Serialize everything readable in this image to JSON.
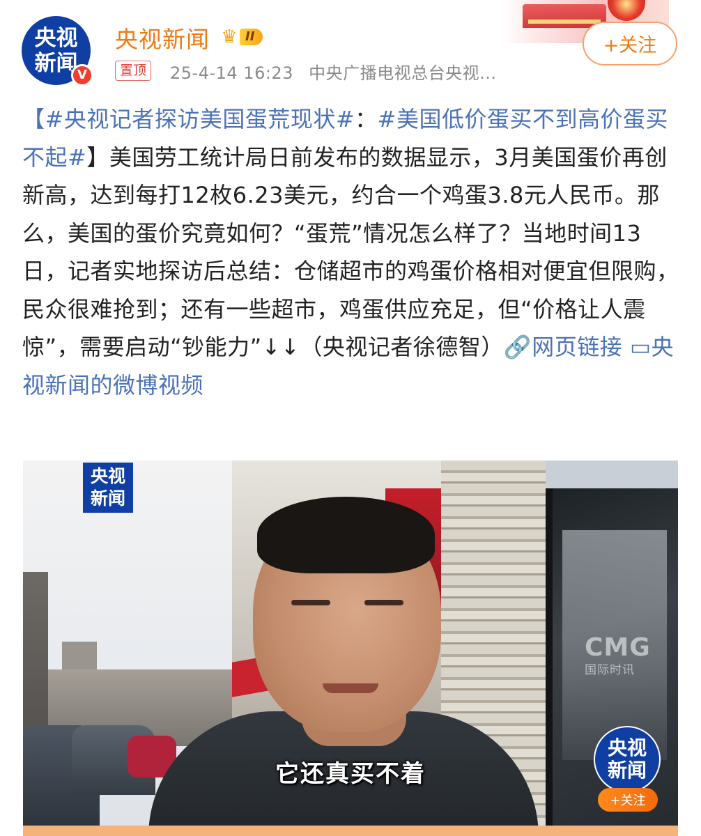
{
  "header": {
    "avatar_line1": "央视",
    "avatar_line2": "新闻",
    "verify_mark": "V",
    "user_name": "央视新闻",
    "vip_level": "II",
    "pin_label": "置顶",
    "timestamp": "25-4-14 16:23",
    "source": "中央广播电视总台央视...",
    "follow_label": "+关注",
    "icons": [
      "avatar-icon",
      "verified-icon",
      "crown-icon",
      "banner-decoration"
    ]
  },
  "post": {
    "tag1": "【#央视记者探访美国蛋荒现状#",
    "sep": "：",
    "tag2": "#美国低价蛋买不到高价蛋买不起#",
    "bracket_close": "】",
    "body": "美国劳工统计局日前发布的数据显示，3月美国蛋价再创新高，达到每打12枚6.23美元，约合一个鸡蛋3.8元人民币。那么，美国的蛋价究竟如何？“蛋荒”情况怎么样了？当地时间13日，记者实地探访后总结：仓储超市的鸡蛋价格相对便宜但限购，民众很难抢到；还有一些超市，鸡蛋供应充足，但“价格让人震惊”，需要启动“钞能力”↓↓（央视记者徐德智）",
    "web_link_icon": "🔗",
    "web_link": "网页链接",
    "video_link_icon": "▭",
    "video_link": "央视新闻的微博视频"
  },
  "video": {
    "logo_tl_line1": "央视",
    "logo_tl_line2": "新闻",
    "watermark": "CMG",
    "watermark_sub": "国际时讯",
    "subtitle": "它还真买不着",
    "logo_br_line1": "央视",
    "logo_br_line2": "新闻",
    "follow_mini": "+关注"
  },
  "colors": {
    "accent_orange": "#f07a12",
    "link_blue": "#4a72b8",
    "brand_blue": "#0f3fa3",
    "pin_red": "#e0413a"
  }
}
